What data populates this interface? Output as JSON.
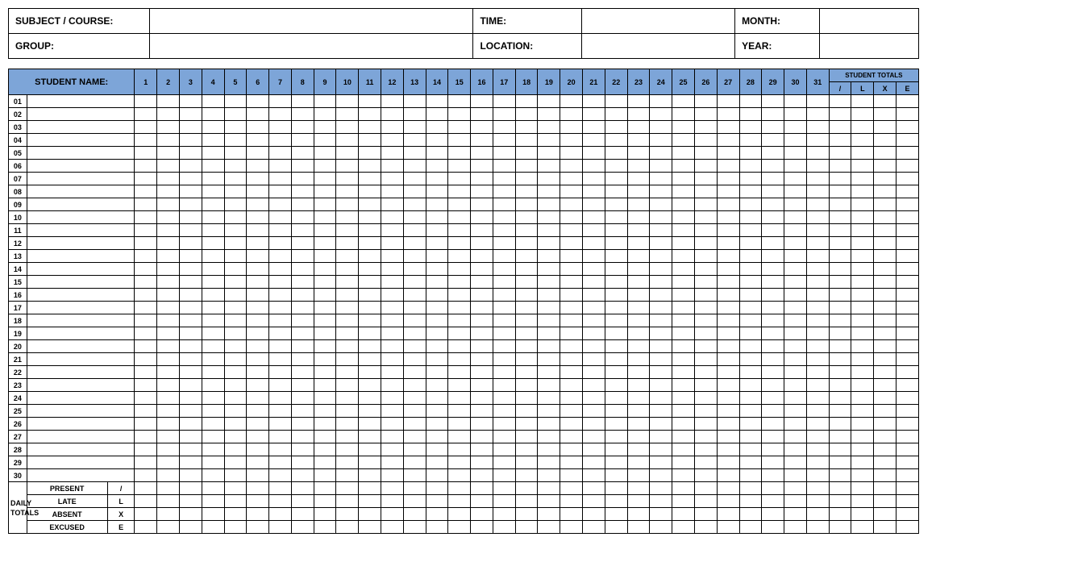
{
  "info": {
    "subject_label": "SUBJECT / COURSE:",
    "subject_value": "",
    "time_label": "TIME:",
    "time_value": "",
    "month_label": "MONTH:",
    "month_value": "",
    "group_label": "GROUP:",
    "group_value": "",
    "location_label": "LOCATION:",
    "location_value": "",
    "year_label": "YEAR:",
    "year_value": ""
  },
  "grid": {
    "student_name_header": "STUDENT NAME:",
    "student_totals_header": "STUDENT TOTALS",
    "totals_codes": [
      "/",
      "L",
      "X",
      "E"
    ],
    "days": [
      "1",
      "2",
      "3",
      "4",
      "5",
      "6",
      "7",
      "8",
      "9",
      "10",
      "11",
      "12",
      "13",
      "14",
      "15",
      "16",
      "17",
      "18",
      "19",
      "20",
      "21",
      "22",
      "23",
      "24",
      "25",
      "26",
      "27",
      "28",
      "29",
      "30",
      "31"
    ],
    "rows": [
      "01",
      "02",
      "03",
      "04",
      "05",
      "06",
      "07",
      "08",
      "09",
      "10",
      "11",
      "12",
      "13",
      "14",
      "15",
      "16",
      "17",
      "18",
      "19",
      "20",
      "21",
      "22",
      "23",
      "24",
      "25",
      "26",
      "27",
      "28",
      "29",
      "30"
    ],
    "daily_totals_label": "DAILY\nTOTALS",
    "legend": [
      {
        "label": "PRESENT",
        "code": "/"
      },
      {
        "label": "LATE",
        "code": "L"
      },
      {
        "label": "ABSENT",
        "code": "X"
      },
      {
        "label": "EXCUSED",
        "code": "E"
      }
    ]
  }
}
